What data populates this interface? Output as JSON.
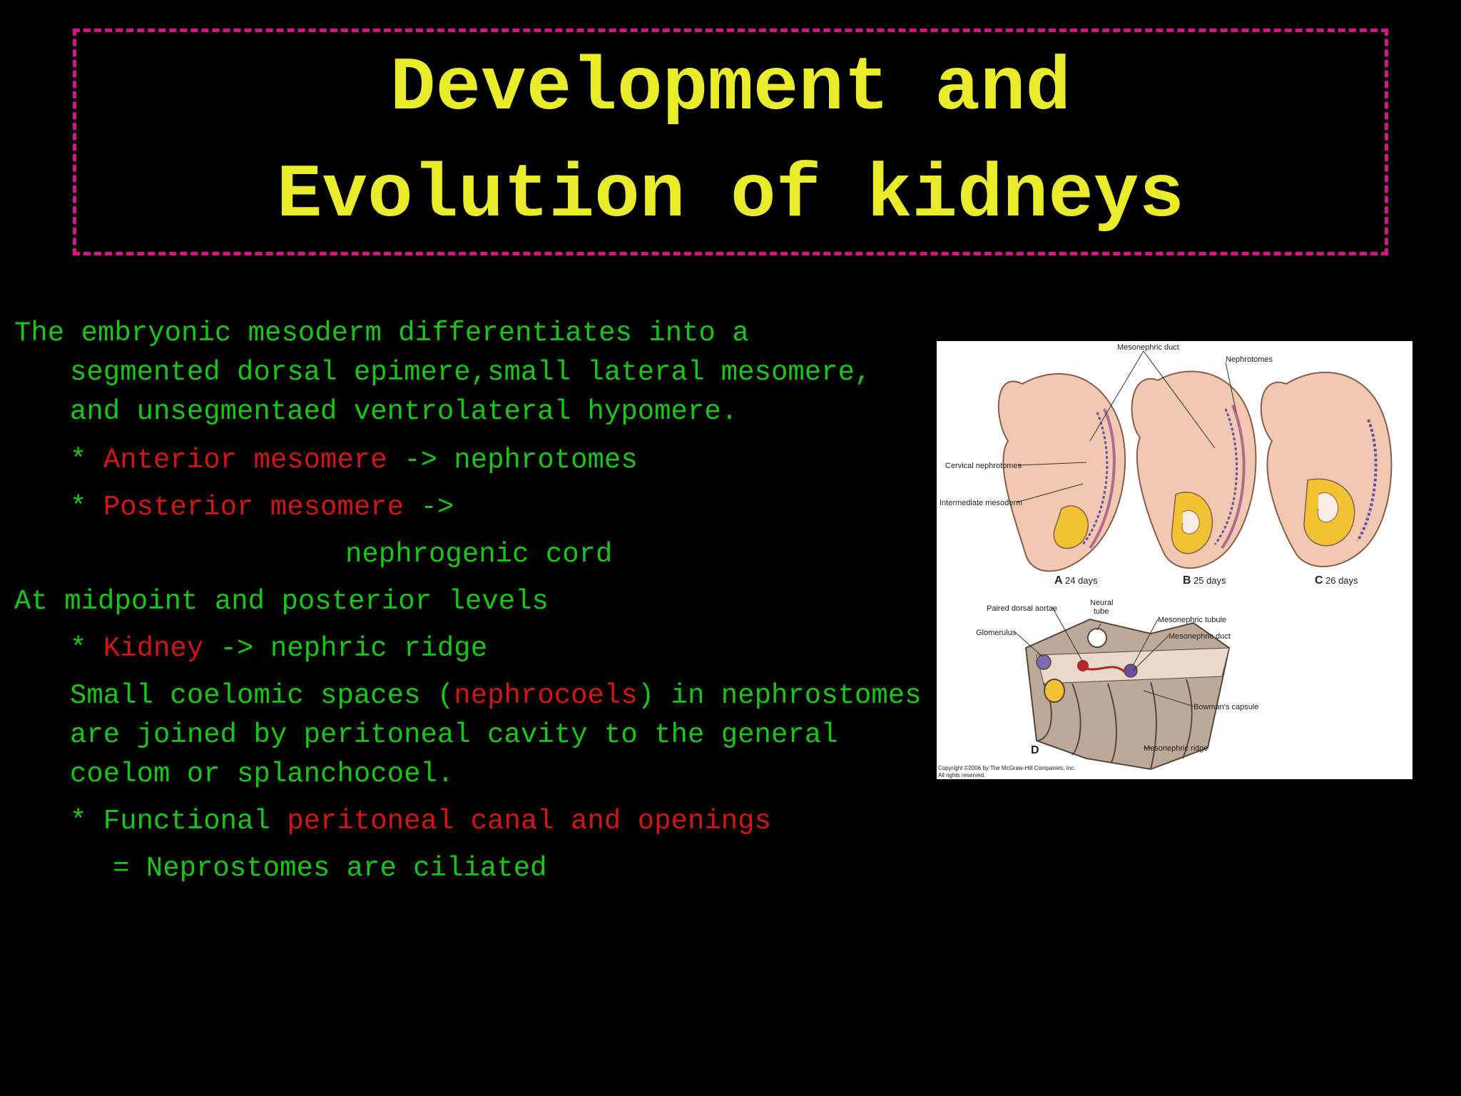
{
  "title": {
    "line1": "Development and",
    "line2": "Evolution of kidneys"
  },
  "body": {
    "p1": "The embryonic mesoderm differentiates into a segmented dorsal epimere,small lateral mesomere, and unsegmentaed ventrolateral hypomere.",
    "b1_star": "* ",
    "b1_red": "Anterior mesomere",
    "b1_rest": " -> nephrotomes",
    "b2_star": "* ",
    "b2_red": "Posterior mesomere",
    "b2_rest": " ->",
    "b2_cont": "nephrogenic cord",
    "p2": "At midpoint and posterior levels",
    "b3_star": "* ",
    "b3_red": "Kidney",
    "b3_rest": " -> nephric ridge",
    "p3_a": "Small coelomic spaces (",
    "p3_red": "nephrocoels",
    "p3_b": ") in nephrostomes are joined by peritoneal cavity to the general coelom or splanchocoel.",
    "b4_star": "* Functional ",
    "b4_red": "peritoneal canal and openings",
    "b5": "= Neprostomes are ciliated"
  },
  "figure": {
    "labels": {
      "mesonephric_duct_top": "Mesonephric duct",
      "nephrotomes": "Nephrotomes",
      "cervical_nephrotomes": "Cervical nephrotomes",
      "intermediate_mesoderm": "Intermediate mesoderm",
      "a_letter": "A",
      "a_days": "24 days",
      "b_letter": "B",
      "b_days": "25 days",
      "c_letter": "C",
      "c_days": "26 days",
      "paired_dorsal_aortae": "Paired dorsal aortae",
      "neural": "Neural",
      "tube": "tube",
      "mesonephric_tubule": "Mesonephric tubule",
      "mesonephric_duct": "Mesonephric duct",
      "glomerulus": "Glomerulus",
      "bowmans_capsule": "Bowman's capsule",
      "d_letter": "D",
      "mesonephric_ridge": "Mesonephric ridge",
      "copyright1": "Copyright ©2006 by The McGraw-Hill Companies, Inc.",
      "copyright2": "All rights reserved."
    },
    "colors": {
      "embryo": "#f1c9b3",
      "embryo_outline": "#8a5c4a",
      "yellow": "#f1c232",
      "purple": "#6a4fa3"
    }
  }
}
